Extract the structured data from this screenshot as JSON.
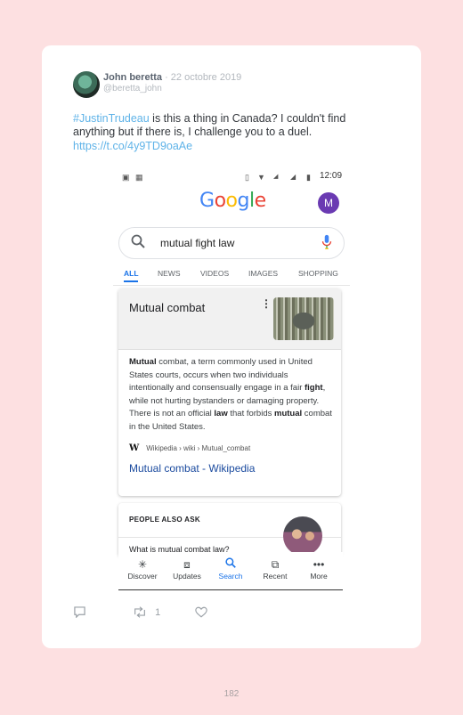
{
  "tweet": {
    "author_name": "John beretta",
    "date": " · 22 octobre 2019",
    "handle": "@beretta_john",
    "hashtag": "#JustinTrudeau",
    "text_line1": " is this a thing in Canada? I couldn't find",
    "text_line2": "anything but if there is, I challenge you to a duel.",
    "link": "https://t.co/4y9TD9oaAe",
    "retweet_count": "1"
  },
  "phone": {
    "status_time": "12:09",
    "google_logo": [
      "G",
      "o",
      "o",
      "g",
      "l",
      "e"
    ],
    "google_colors": [
      "#4285f4",
      "#ea4335",
      "#fbbc05",
      "#4285f4",
      "#34a853",
      "#ea4335"
    ],
    "profile_initial": "M",
    "search_query": "mutual fight law",
    "tabs": [
      "ALL",
      "NEWS",
      "VIDEOS",
      "IMAGES",
      "SHOPPING"
    ],
    "result": {
      "title": "Mutual combat",
      "snippet_parts": [
        {
          "b": true,
          "t": "Mutual"
        },
        {
          "b": false,
          "t": " combat, a term commonly used in United States courts, occurs when two individuals intentionally and consensually engage in a fair "
        },
        {
          "b": true,
          "t": "fight"
        },
        {
          "b": false,
          "t": ", while not hurting bystanders or damaging property. There is not an official "
        },
        {
          "b": true,
          "t": "law"
        },
        {
          "b": false,
          "t": " that forbids "
        },
        {
          "b": true,
          "t": "mutual"
        },
        {
          "b": false,
          "t": " combat in the United States."
        }
      ],
      "source_breadcrumb": "Wikipedia › wiki › Mutual_combat",
      "link_text": "Mutual combat - Wikipedia"
    },
    "people_also_ask": {
      "title": "PEOPLE ALSO ASK",
      "first_question": "What is mutual combat law?"
    },
    "bottom_nav": [
      {
        "label": "Discover",
        "icon": "asterisk-icon"
      },
      {
        "label": "Updates",
        "icon": "inbox-icon"
      },
      {
        "label": "Search",
        "icon": "search-icon"
      },
      {
        "label": "Recent",
        "icon": "tabs-icon"
      },
      {
        "label": "More",
        "icon": "more-icon"
      }
    ]
  },
  "page_number": "182"
}
